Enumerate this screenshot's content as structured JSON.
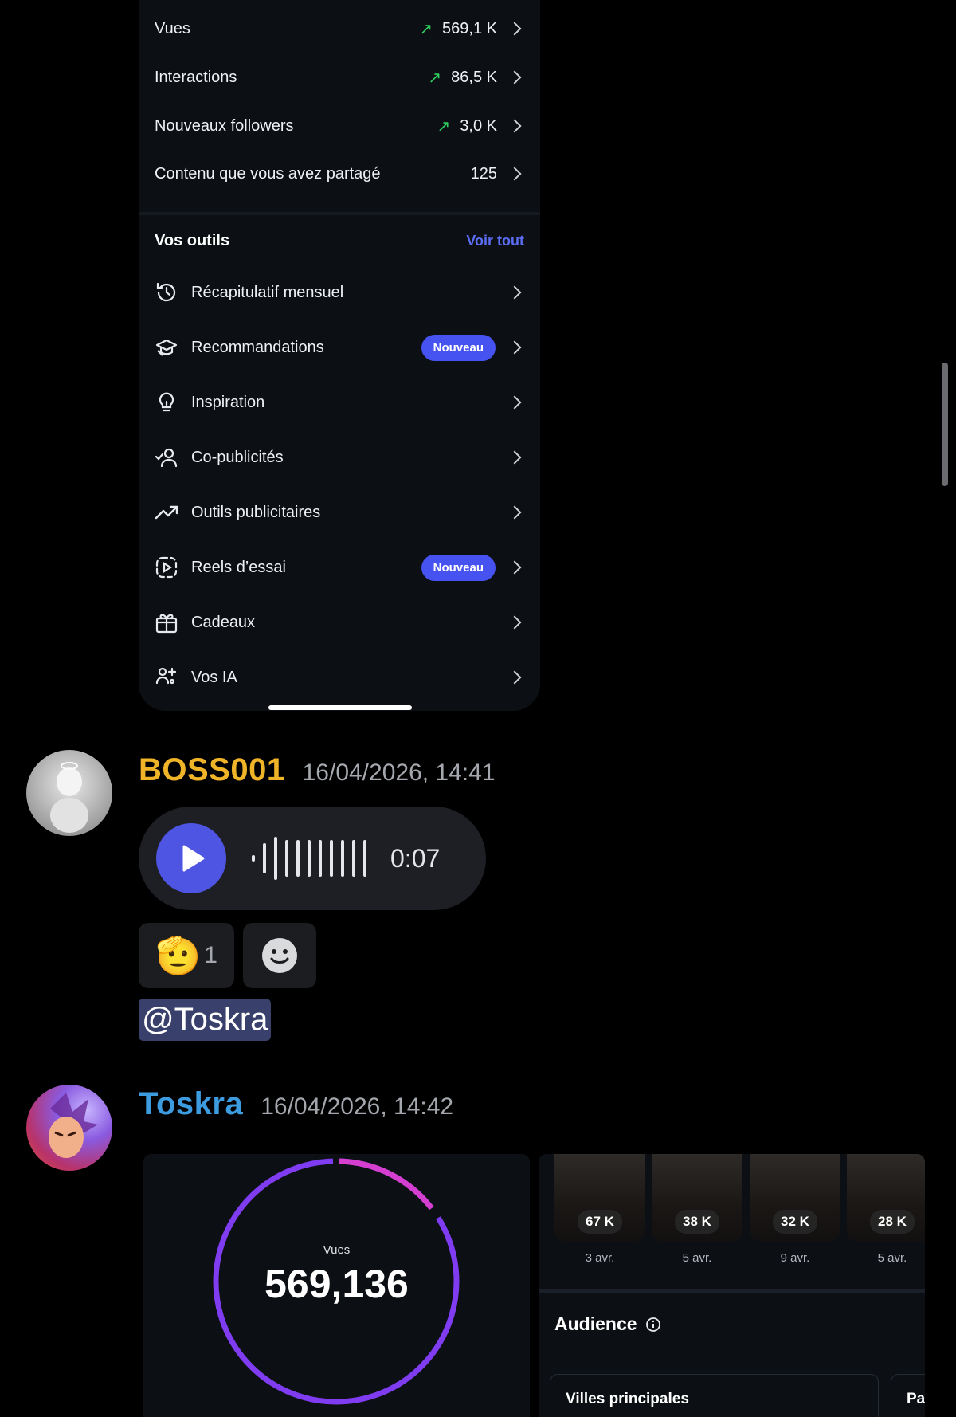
{
  "insights": {
    "stats": [
      {
        "label": "Vues",
        "value": "569,1 K",
        "trend": "↗"
      },
      {
        "label": "Interactions",
        "value": "86,5 K",
        "trend": "↗"
      },
      {
        "label": "Nouveaux followers",
        "value": "3,0 K",
        "trend": "↗"
      },
      {
        "label": "Contenu que vous avez partagé",
        "value": "125",
        "trend": ""
      }
    ],
    "tools_title": "Vos outils",
    "see_all": "Voir tout",
    "tools": [
      {
        "label": "Récapitulatif mensuel",
        "icon": "history-icon",
        "badge": ""
      },
      {
        "label": "Recommandations",
        "icon": "graduation-cap-icon",
        "badge": "Nouveau"
      },
      {
        "label": "Inspiration",
        "icon": "lightbulb-icon",
        "badge": ""
      },
      {
        "label": "Co-publicités",
        "icon": "user-check-icon",
        "badge": ""
      },
      {
        "label": "Outils publicitaires",
        "icon": "trending-up-icon",
        "badge": ""
      },
      {
        "label": "Reels d’essai",
        "icon": "reel-trial-icon",
        "badge": "Nouveau"
      },
      {
        "label": "Cadeaux",
        "icon": "gift-icon",
        "badge": ""
      },
      {
        "label": "Vos IA",
        "icon": "ai-users-icon",
        "badge": ""
      }
    ]
  },
  "messages": [
    {
      "username": "BOSS001",
      "username_color": "#f0b429",
      "timestamp": "16/04/2026, 14:41",
      "voice": {
        "duration": "0:07"
      },
      "reactions": [
        {
          "emoji": "🫡",
          "count": "1"
        }
      ],
      "mention": "@Toskra"
    },
    {
      "username": "Toskra",
      "username_color": "#3d9be0",
      "timestamp": "16/04/2026, 14:42",
      "attachment_views": {
        "label": "Vues",
        "value": "569,136"
      },
      "reels": [
        {
          "views": "67 K",
          "date": "3 avr."
        },
        {
          "views": "38 K",
          "date": "5 avr."
        },
        {
          "views": "32 K",
          "date": "9 avr."
        },
        {
          "views": "28 K",
          "date": "5 avr."
        }
      ],
      "audience_title": "Audience",
      "audience_card_title": "Villes principales",
      "audience_card2_title": "Pa"
    }
  ],
  "colors": {
    "accent": "#4f55e3",
    "badge": "#4753f0",
    "trend_up": "#2fcf5f",
    "link": "#5b6cf5"
  }
}
